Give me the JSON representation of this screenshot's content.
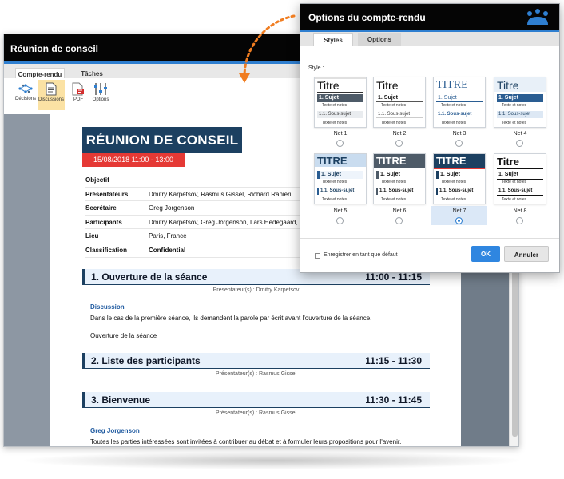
{
  "main_window": {
    "title": "Réunion de conseil",
    "tabs": [
      {
        "label": "Compte-rendu",
        "active": true
      },
      {
        "label": "Tâches",
        "active": false
      }
    ],
    "ribbon": [
      {
        "label": "Décisions",
        "icon": "decisions-icon"
      },
      {
        "label": "Discussions",
        "icon": "discussions-icon",
        "active": true
      },
      {
        "label": "PDF",
        "icon": "pdf-icon"
      },
      {
        "label": "Options",
        "icon": "options-icon"
      }
    ]
  },
  "document": {
    "title": "RÉUNION DE CONSEIL",
    "date": "15/08/2018 11:00 - 13:00",
    "info": [
      {
        "key": "Objectif",
        "value": ""
      },
      {
        "key": "Présentateurs",
        "value": "Dmitry Karpetsov, Rasmus Gissel, Richard Ranieri"
      },
      {
        "key": "Secrétaire",
        "value": "Greg Jorgenson"
      },
      {
        "key": "Participants",
        "value": "Dmitry Karpetsov, Greg Jorgenson, Lars Hedegaard, R"
      },
      {
        "key": "Lieu",
        "value": "Paris, France"
      },
      {
        "key": "Classification",
        "value": "Confidential"
      }
    ],
    "sections": [
      {
        "title": "1. Ouverture de la séance",
        "time": "11:00 - 11:15",
        "presenter": "Présentateur(s) : Dmitry Karpetsov",
        "subheading": "Discussion",
        "paragraphs": [
          "Dans le cas de la première séance, ils demandent la parole par écrit avant l'ouverture de la séance.",
          "Ouverture de la séance"
        ]
      },
      {
        "title": "2. Liste des participants",
        "time": "11:15 - 11:30",
        "presenter": "Présentateur(s) : Rasmus Gissel"
      },
      {
        "title": "3. Bienvenue",
        "time": "11:30 - 11:45",
        "presenter": "Présentateur(s) : Rasmus Gissel",
        "subheading": "Greg Jorgenson",
        "paragraphs": [
          "Toutes les parties intéressées sont invitées à contribuer au débat et à formuler leurs propositions pour l'avenir."
        ]
      }
    ]
  },
  "dialog": {
    "title": "Options du compte-rendu",
    "tabs": [
      {
        "label": "Styles",
        "active": true
      },
      {
        "label": "Options",
        "active": false
      }
    ],
    "style_label": "Style :",
    "styles": [
      {
        "name": "Net 1",
        "title": "Titre",
        "subject": "1. Sujet",
        "notes": "Texte et notes",
        "subsubject": "1.1. Sous-sujet",
        "notes2": "Texte et notes",
        "selected": false
      },
      {
        "name": "Net 2",
        "title": "Titre",
        "subject": "1. Sujet",
        "notes": "Texte et notes",
        "subsubject": "1.1. Sous-sujet",
        "notes2": "Texte et notes",
        "selected": false
      },
      {
        "name": "Net 3",
        "title": "TITRE",
        "subject": "1. Sujet",
        "notes": "Texte et notes",
        "subsubject": "1.1. Sous-sujet",
        "notes2": "Texte et notes",
        "selected": false
      },
      {
        "name": "Net 4",
        "title": "Titre",
        "subject": "1. Sujet",
        "notes": "Texte et notes",
        "subsubject": "1.1. Sous-sujet",
        "notes2": "Texte et notes",
        "selected": false
      },
      {
        "name": "Net 5",
        "title": "TITRE",
        "subject": "1. Sujet",
        "notes": "Texte et notes",
        "subsubject": "1.1. Sous-sujet",
        "notes2": "Texte et notes",
        "selected": false
      },
      {
        "name": "Net 6",
        "title": "TITRE",
        "subject": "1. Sujet",
        "notes": "Texte et notes",
        "subsubject": "1.1. Sous-sujet",
        "notes2": "Texte et notes",
        "selected": false
      },
      {
        "name": "Net 7",
        "title": "TITRE",
        "subject": "1. Sujet",
        "notes": "Texte et notes",
        "subsubject": "1.1. Sous-sujet",
        "notes2": "Texte et notes",
        "selected": true
      },
      {
        "name": "Net 8",
        "title": "Titre",
        "subject": "1. Sujet",
        "notes": "Texte et notes",
        "subsubject": "1.1. Sous-sujet",
        "notes2": "Texte et notes",
        "selected": false
      }
    ],
    "save_default_label": "Enregistrer en tant que défaut",
    "ok_label": "OK",
    "cancel_label": "Annuler"
  },
  "colors": {
    "accent_blue": "#2f7fd0",
    "doc_navy": "#1c4061",
    "date_red": "#e53935",
    "orange_arrow": "#f07d21"
  }
}
